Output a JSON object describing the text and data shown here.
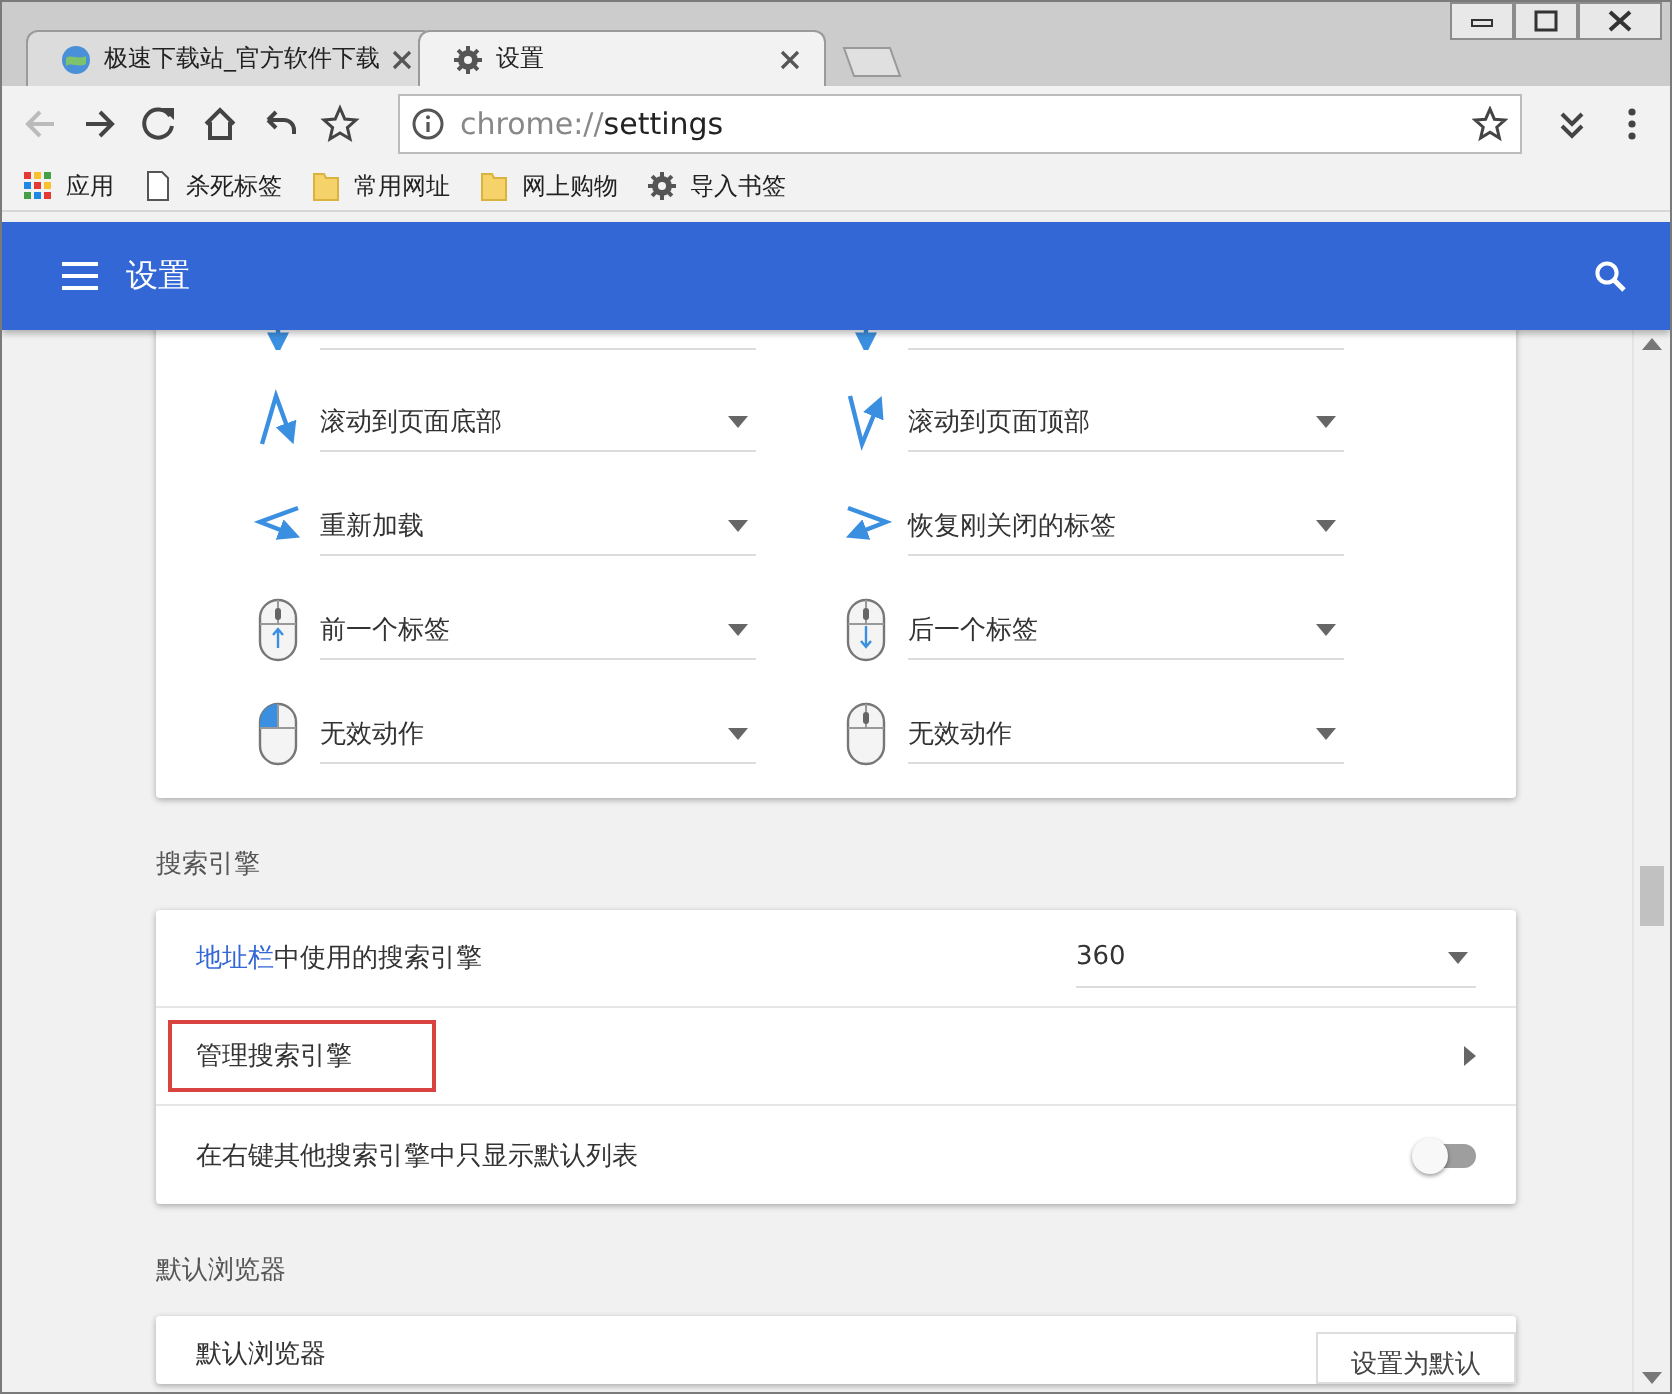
{
  "tabs": [
    {
      "title": "极速下载站_官方软件下载",
      "selected": false
    },
    {
      "title": "设置",
      "selected": true
    }
  ],
  "address": {
    "scheme": "chrome://",
    "path": "settings"
  },
  "bookmarks": [
    {
      "label": "应用",
      "kind": "apps"
    },
    {
      "label": "杀死标签",
      "kind": "page"
    },
    {
      "label": "常用网址",
      "kind": "folder"
    },
    {
      "label": "网上购物",
      "kind": "folder"
    },
    {
      "label": "导入书签",
      "kind": "gear"
    }
  ],
  "header": {
    "title": "设置"
  },
  "gestures": [
    {
      "kind": "down"
    },
    {
      "kind": "down"
    },
    {
      "kind": "updown",
      "action": "滚动到页面底部"
    },
    {
      "kind": "downup",
      "action": "滚动到页面顶部"
    },
    {
      "kind": "left",
      "action": "重新加载"
    },
    {
      "kind": "right",
      "action": "恢复刚关闭的标签"
    },
    {
      "kind": "wheelup",
      "action": "前一个标签"
    },
    {
      "kind": "wheeldown",
      "action": "后一个标签"
    },
    {
      "kind": "leftclick",
      "action": "无效动作"
    },
    {
      "kind": "middleclick",
      "action": "无效动作"
    }
  ],
  "search_engine": {
    "heading": "搜索引擎",
    "rows": [
      {
        "kind": "select",
        "link": "地址栏",
        "label": "中使用的搜索引擎",
        "value": "360"
      },
      {
        "kind": "link",
        "label": "管理搜索引擎",
        "highlighted": true
      },
      {
        "kind": "toggle",
        "label": "在右键其他搜索引擎中只显示默认列表",
        "on": false
      }
    ]
  },
  "default_browser": {
    "heading": "默认浏览器",
    "title": "默认浏览器",
    "button": "设置为默认"
  }
}
